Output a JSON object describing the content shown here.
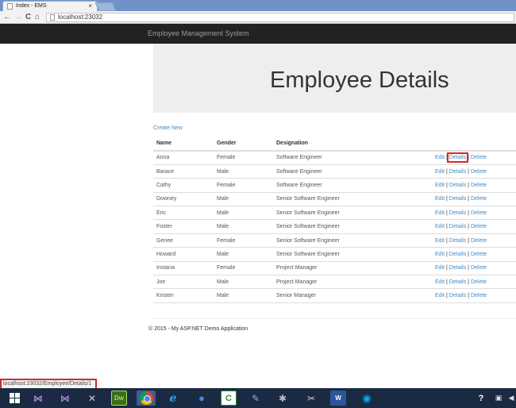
{
  "browser": {
    "tab_title": "Index - EMS",
    "tab_close": "×",
    "url": "localhost:23032",
    "nav": {
      "back": "←",
      "forward": "→",
      "reload": "C",
      "home": "⌂"
    }
  },
  "app": {
    "brand": "Employee Management System"
  },
  "page": {
    "title": "Employee Details",
    "create_new": "Create New"
  },
  "table": {
    "headers": [
      "Name",
      "Gender",
      "Designation"
    ],
    "action_labels": {
      "edit": "Edit",
      "details": "Details",
      "delete": "Delete",
      "separator": "|"
    },
    "rows": [
      [
        "Anna",
        "Female",
        "Software Engineer"
      ],
      [
        "Barace",
        "Male",
        "Software Engineer"
      ],
      [
        "Cathy",
        "Female",
        "Software Engineer"
      ],
      [
        "Downey",
        "Male",
        "Senior Software Engineer"
      ],
      [
        "Eric",
        "Male",
        "Senior Software Engineer"
      ],
      [
        "Foster",
        "Male",
        "Senior Software Engineer"
      ],
      [
        "Genee",
        "Female",
        "Senior Software Engineer"
      ],
      [
        "Howard",
        "Male",
        "Senior Software Engineer"
      ],
      [
        "Instana",
        "Female",
        "Project Manager"
      ],
      [
        "Joe",
        "Male",
        "Project Manager"
      ],
      [
        "Kristen",
        "Male",
        "Senior Manager"
      ]
    ]
  },
  "footer": {
    "text": "© 2015 - My ASP.NET Demo Application"
  },
  "status": {
    "url": "localhost:23032/Employee/Details/1"
  },
  "taskbar": {
    "icons": [
      "windows-start-icon",
      "visual-studio-icon",
      "visual-studio-icon",
      "tools-icon",
      "dreamweaver-icon",
      "chrome-icon",
      "internet-explorer-icon",
      "outlook-icon",
      "camtasia-icon",
      "paint-icon",
      "app-icon",
      "snipping-icon",
      "word-icon",
      "skype-icon",
      "help-icon"
    ],
    "labels": {
      "dw": "Dw",
      "ie": "e",
      "camtasia": "C",
      "word": "W",
      "help": "?"
    }
  },
  "colors": {
    "navbar": "#222222",
    "link": "#428bca",
    "highlight": "#d42b2b",
    "taskbar": "#1b2a43"
  }
}
